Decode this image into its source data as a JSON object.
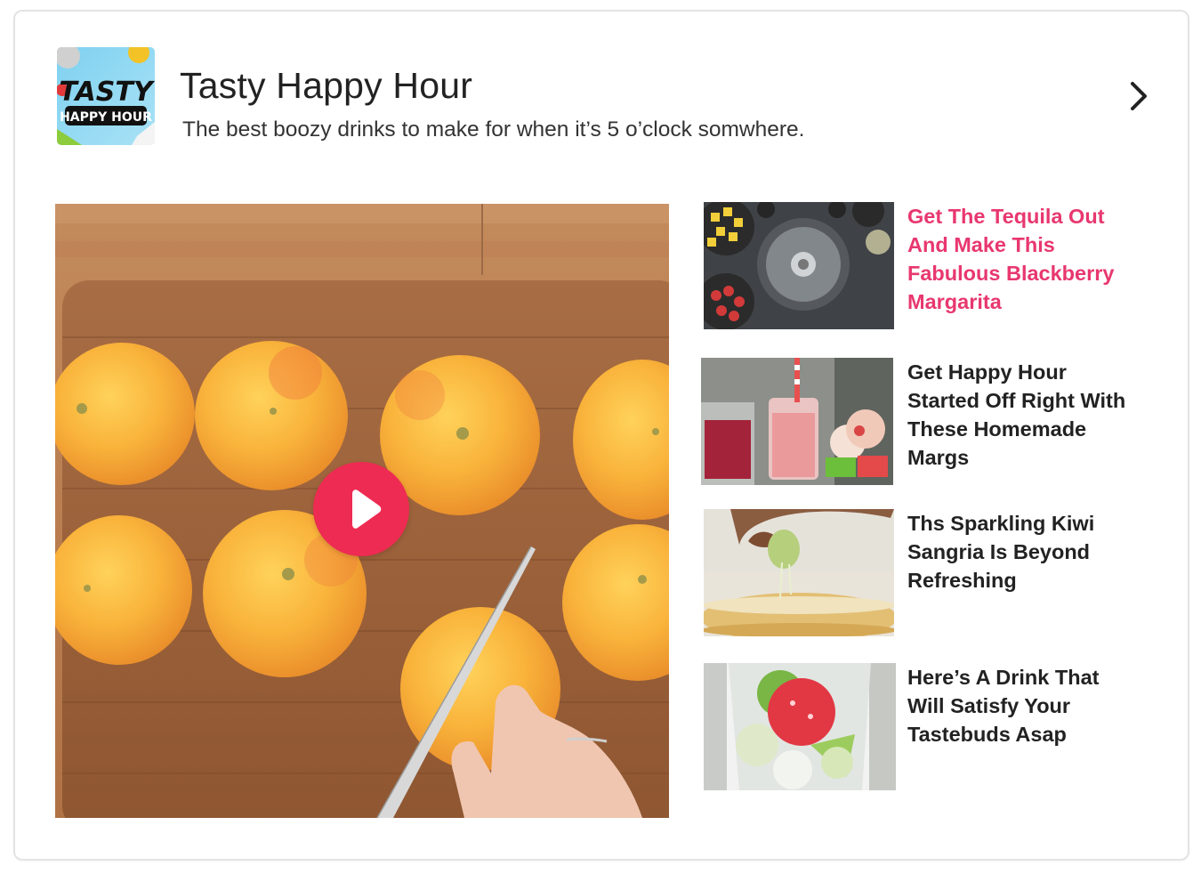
{
  "header": {
    "logo": {
      "text_top": "TASTY",
      "text_bottom": "HAPPY HOUR"
    },
    "title": "Tasty Happy Hour",
    "subtitle": "The best boozy drinks to make for when it’s 5 o’clock somwhere.",
    "next_icon": "chevron-right-icon"
  },
  "main_video": {
    "play_icon": "play-icon",
    "play_color": "#ee2b52"
  },
  "related": [
    {
      "title": "Get The Tequila Out And Make This Fabulous Blackberry Margarita",
      "active": true
    },
    {
      "title": "Get Happy Hour Started Off Right With These Homemade Margs",
      "active": false
    },
    {
      "title": "Ths Sparkling Kiwi Sangria Is Beyond Refreshing",
      "active": false
    },
    {
      "title": "Here’s A Drink That Will Satisfy Your Tastebuds Asap",
      "active": false
    }
  ],
  "colors": {
    "accent": "#e8376f",
    "text": "#222222",
    "border": "#e3e3e3"
  }
}
